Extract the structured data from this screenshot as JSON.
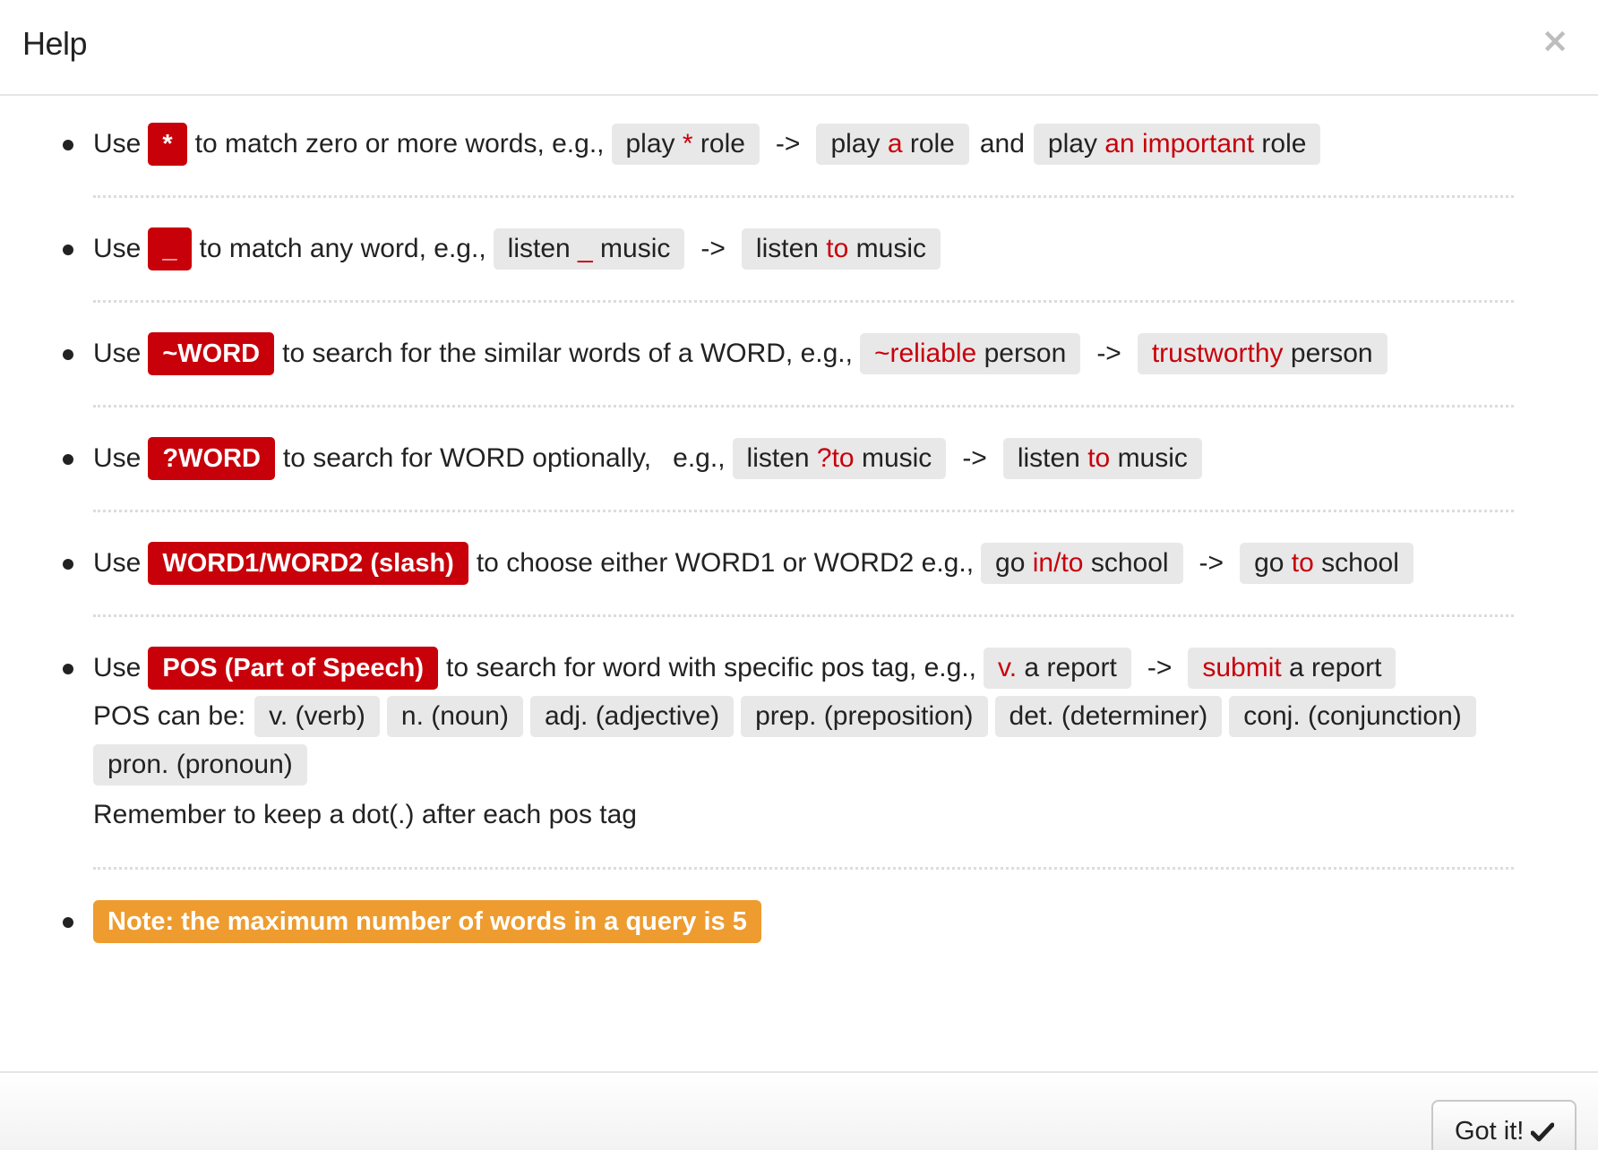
{
  "header": {
    "title": "Help",
    "close_glyph": "×"
  },
  "items": {
    "star": {
      "use": "Use",
      "keyword": "*",
      "desc": "to match zero or more words, e.g.,",
      "ex1": [
        "play ",
        "*",
        " role"
      ],
      "arrow": "->",
      "ex2": [
        "play ",
        "a",
        " role"
      ],
      "and": "and",
      "ex3": [
        "play ",
        "an important",
        " role"
      ]
    },
    "underscore": {
      "use": "Use",
      "keyword": "_",
      "desc": "to match any word, e.g.,",
      "ex1": [
        "listen ",
        "_",
        " music"
      ],
      "arrow": "->",
      "ex2": [
        "listen ",
        "to",
        " music"
      ]
    },
    "similar": {
      "use": "Use",
      "keyword": "~WORD",
      "desc": "to search for the similar words of a WORD, e.g.,",
      "ex1": [
        "~reliable",
        " person"
      ],
      "arrow": "->",
      "ex2": [
        "trustworthy",
        " person"
      ]
    },
    "optional": {
      "use": "Use",
      "keyword": "?WORD",
      "desc": "to search for WORD optionally,",
      "eg": "e.g.,",
      "ex1": [
        "listen ",
        "?to",
        " music"
      ],
      "arrow": "->",
      "ex2": [
        "listen ",
        "to",
        " music"
      ]
    },
    "slash": {
      "use": "Use",
      "keyword": "WORD1/WORD2 (slash)",
      "desc": "to choose either WORD1 or WORD2 e.g.,",
      "ex1": [
        "go ",
        "in/to",
        " school"
      ],
      "arrow": "->",
      "ex2": [
        "go ",
        "to",
        " school"
      ]
    },
    "pos": {
      "use": "Use",
      "keyword": "POS (Part of Speech)",
      "desc": "to search for word with specific pos tag, e.g.,",
      "ex1": [
        "v.",
        " a report"
      ],
      "arrow": "->",
      "ex2": [
        "submit",
        " a report"
      ],
      "pos_label": "POS can be:",
      "tags": [
        "v. (verb)",
        "n. (noun)",
        "adj. (adjective)",
        "prep. (preposition)",
        "det. (determiner)",
        "conj. (conjunction)",
        "pron. (pronoun)"
      ],
      "reminder": "Remember to keep a dot(.) after each pos tag"
    },
    "note": "Note: the maximum number of words in a query is 5"
  },
  "footer": {
    "got_it_label": "Got it!",
    "got_it_icon": "checkmark-icon"
  },
  "colors": {
    "keyword_red": "#c8000a",
    "example_bg": "#e8e8e8",
    "note_orange": "#ee9c2f"
  }
}
